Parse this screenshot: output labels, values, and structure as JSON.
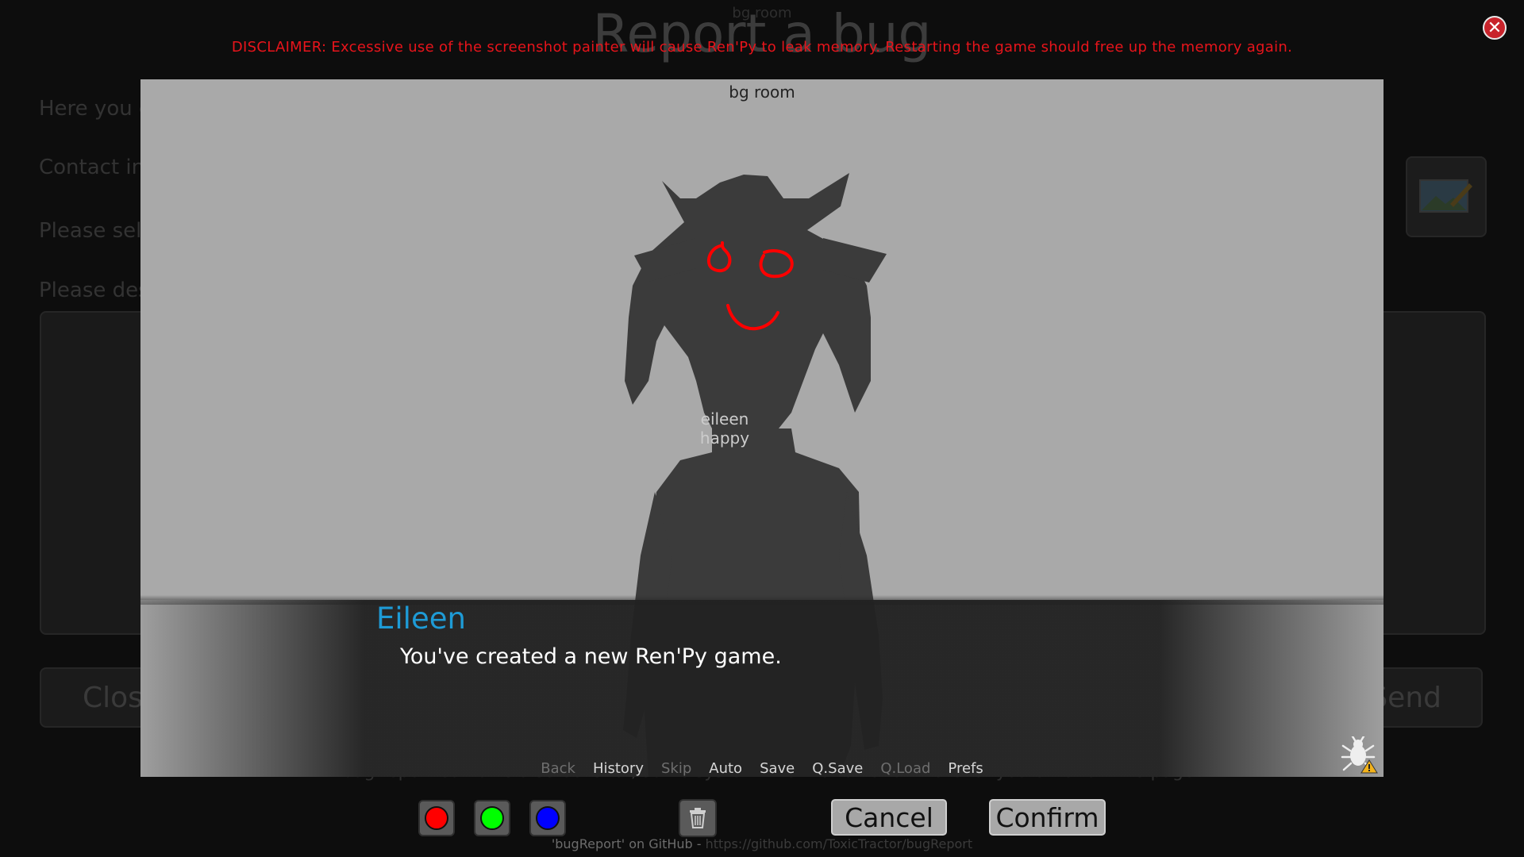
{
  "background_page": {
    "title": "Report a bug",
    "top_caption": "bg room",
    "labels": [
      "Here you c",
      "Contact inf",
      "Please sele",
      "Please des"
    ],
    "close_label": "Clos",
    "send_label": "Send",
    "footer_text": "A bug report contains a screenshot, some system information and whatever you enter on this page."
  },
  "disclaimer": "DISCLAIMER: Excessive use of the screenshot painter will cause Ren'Py to leak memory. Restarting the game should free up the memory again.",
  "screenshot": {
    "scene_label": "bg room",
    "sprite_label_line1": "eileen",
    "sprite_label_line2": "happy",
    "speaker": "Eileen",
    "dialogue": "You've created a new Ren'Py game.",
    "quick_menu": [
      {
        "label": "Back",
        "enabled": false
      },
      {
        "label": "History",
        "enabled": true
      },
      {
        "label": "Skip",
        "enabled": false
      },
      {
        "label": "Auto",
        "enabled": true
      },
      {
        "label": "Save",
        "enabled": true
      },
      {
        "label": "Q.Save",
        "enabled": true
      },
      {
        "label": "Q.Load",
        "enabled": false
      },
      {
        "label": "Prefs",
        "enabled": true
      }
    ]
  },
  "toolbar": {
    "colors": [
      {
        "name": "red",
        "hex": "#ff0000"
      },
      {
        "name": "green",
        "hex": "#00ff00"
      },
      {
        "name": "blue",
        "hex": "#0000ff"
      }
    ],
    "clear_icon": "trash-icon",
    "cancel_label": "Cancel",
    "confirm_label": "Confirm"
  },
  "footer": {
    "text": "'bugReport' on GitHub - ",
    "link": "https://github.com/ToxicTractor/bugReport"
  },
  "colors": {
    "accent_name": "#1e9bd6",
    "disclaimer": "#e8141b",
    "paint_stroke": "#ff0000"
  }
}
